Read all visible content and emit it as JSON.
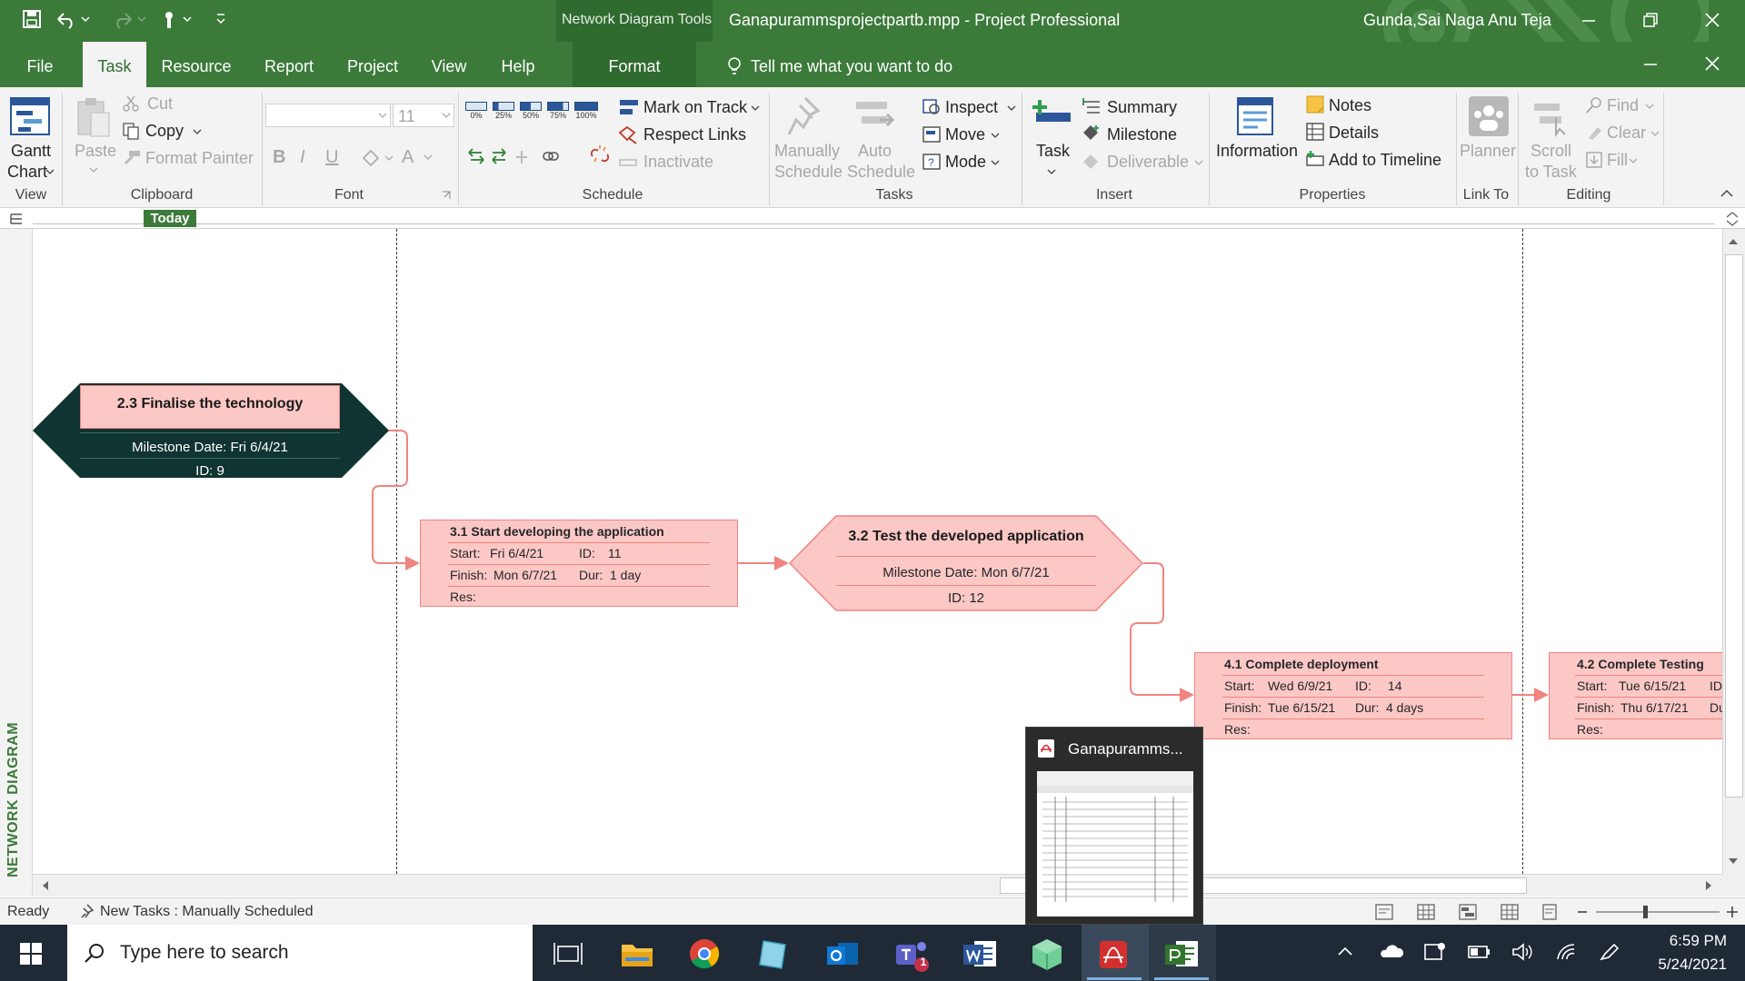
{
  "titlebar": {
    "contextual_group": "Network Diagram Tools",
    "document_title": "Ganapurammsprojectpartb.mpp  -  Project Professional",
    "user_name": "Gunda,Sai Naga Anu Teja"
  },
  "tabs": {
    "file": "File",
    "task": "Task",
    "resource": "Resource",
    "report": "Report",
    "project": "Project",
    "view": "View",
    "help": "Help",
    "format": "Format",
    "tell_me": "Tell me what you want to do"
  },
  "ribbon": {
    "view": {
      "gantt_chart": "Gantt",
      "gantt_chart2": "Chart",
      "group": "View"
    },
    "clipboard": {
      "paste": "Paste",
      "cut": "Cut",
      "copy": "Copy",
      "format_painter": "Format Painter",
      "group": "Clipboard"
    },
    "font": {
      "size": "11",
      "bold": "B",
      "italic": "I",
      "underline": "U",
      "font_color": "A",
      "group": "Font"
    },
    "schedule": {
      "pct": [
        "0%",
        "25%",
        "50%",
        "75%",
        "100%"
      ],
      "mark_on_track": "Mark on Track",
      "respect_links": "Respect Links",
      "inactivate": "Inactivate",
      "group": "Schedule"
    },
    "tasks": {
      "manually": "Manually",
      "schedule1": "Schedule",
      "auto": "Auto",
      "schedule2": "Schedule",
      "inspect": "Inspect",
      "move": "Move",
      "mode": "Mode",
      "group": "Tasks"
    },
    "insert": {
      "task": "Task",
      "summary": "Summary",
      "milestone": "Milestone",
      "deliverable": "Deliverable",
      "group": "Insert"
    },
    "properties": {
      "information": "Information",
      "notes": "Notes",
      "details": "Details",
      "add_to_timeline": "Add to Timeline",
      "group": "Properties"
    },
    "link_to": {
      "planner": "Planner",
      "group": "Link To"
    },
    "editing": {
      "scroll": "Scroll",
      "to_task": "to Task",
      "find": "Find",
      "clear": "Clear",
      "fill": "Fill",
      "group": "Editing"
    }
  },
  "timeline": {
    "today": "Today"
  },
  "sidebar_label": "NETWORK DIAGRAM",
  "nodes": {
    "n9": {
      "title": "2.3 Finalise the technology",
      "milestone": "Milestone Date: Fri 6/4/21",
      "id": "ID: 9"
    },
    "n11": {
      "title": "3.1 Start developing the application",
      "start_label": "Start:",
      "start": "Fri 6/4/21",
      "id_label": "ID:",
      "id": "11",
      "finish_label": "Finish:",
      "finish": "Mon 6/7/21",
      "dur_label": "Dur:",
      "dur": "1 day",
      "res": "Res:"
    },
    "n12": {
      "title": "3.2 Test the developed application",
      "milestone": "Milestone Date: Mon 6/7/21",
      "id": "ID: 12"
    },
    "n14": {
      "title": "4.1 Complete deployment",
      "start_label": "Start:",
      "start": "Wed 6/9/21",
      "id_label": "ID:",
      "id": "14",
      "finish_label": "Finish:",
      "finish": "Tue 6/15/21",
      "dur_label": "Dur:",
      "dur": "4 days",
      "res": "Res:"
    },
    "n15": {
      "title": "4.2 Complete Testing",
      "start_label": "Start:",
      "start": "Tue 6/15/21",
      "id_label": "ID:",
      "finish_label": "Finish:",
      "finish": "Thu 6/17/21",
      "dur_label": "Du",
      "res": "Res:"
    }
  },
  "thumbnail": {
    "title": "Ganapuramms..."
  },
  "statusbar": {
    "ready": "Ready",
    "new_tasks": "New Tasks : Manually Scheduled"
  },
  "taskbar": {
    "search_placeholder": "Type here to search",
    "time": "6:59 PM",
    "date": "5/24/2021",
    "teams_badge": "1"
  },
  "colors": {
    "brand_green": "#3c7a3a",
    "task_fill": "#fbc8c6",
    "task_border": "#f08480",
    "milestone_dark": "#0f3431",
    "taskbar": "#1f2a36"
  }
}
